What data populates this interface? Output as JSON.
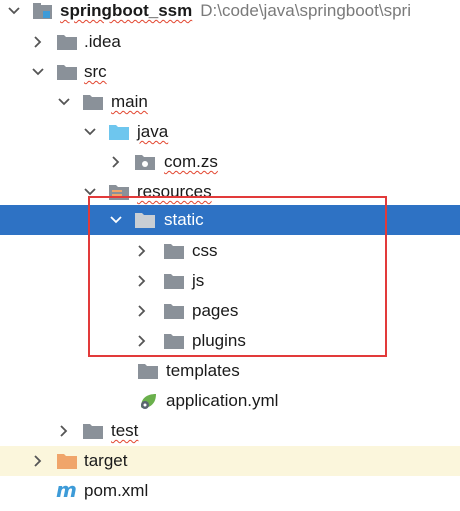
{
  "project": {
    "name": "springboot_ssm",
    "path": "D:\\code\\java\\springboot\\spri"
  },
  "tree": {
    "idea": ".idea",
    "src": "src",
    "main": "main",
    "java": "java",
    "com_zs": "com.zs",
    "resources": "resources",
    "static": "static",
    "css": "css",
    "js": "js",
    "pages": "pages",
    "plugins": "plugins",
    "templates": "templates",
    "application_yml": "application.yml",
    "test": "test",
    "target": "target",
    "pom_xml": "pom.xml"
  },
  "colors": {
    "selection": "#2e72c4",
    "folder": "#8a9199",
    "java_folder": "#6ec6ee",
    "target_folder": "#f0a56a",
    "highlight_box": "#e23a3a",
    "maven": "#3d9bd8",
    "spring_leaf": "#6ab04c"
  },
  "icons": {
    "collapsed": "chevron-right-icon",
    "expanded": "chevron-down-icon",
    "folder": "folder-icon",
    "source_folder": "source-folder-icon",
    "package": "package-icon",
    "resources_folder": "resources-folder-icon",
    "excluded_folder": "excluded-folder-icon",
    "yml": "spring-config-icon",
    "maven": "maven-icon",
    "module": "module-icon"
  }
}
